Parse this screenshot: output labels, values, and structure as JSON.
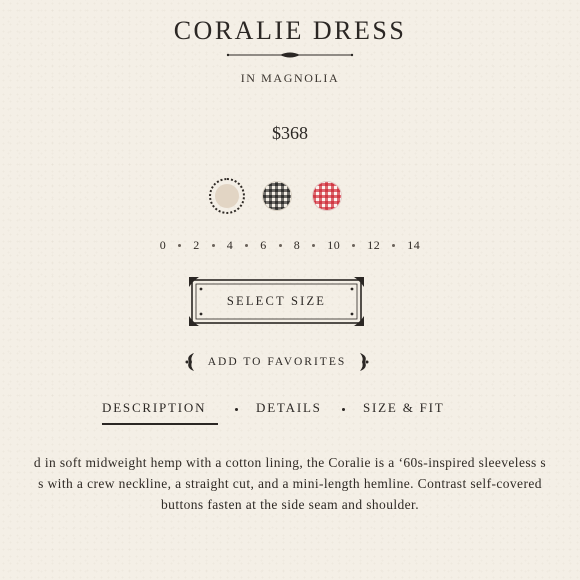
{
  "product": {
    "title": "CORALIE DRESS",
    "color_line": "IN MAGNOLIA",
    "price": "$368"
  },
  "swatches": [
    {
      "name": "Magnolia",
      "color": "#e2d5c4",
      "selected": true
    },
    {
      "name": "Black Gingham",
      "color": "#1d1d1d",
      "selected": false
    },
    {
      "name": "Red Gingham",
      "color": "#cd1e2d",
      "selected": false
    }
  ],
  "sizes": [
    "0",
    "2",
    "4",
    "6",
    "8",
    "10",
    "12",
    "14"
  ],
  "actions": {
    "select_size": "SELECT SIZE",
    "add_to_favorites": "ADD TO FAVORITES"
  },
  "tabs": [
    {
      "label": "DESCRIPTION",
      "active": true
    },
    {
      "label": "DETAILS",
      "active": false
    },
    {
      "label": "SIZE & FIT",
      "active": false
    }
  ],
  "description": {
    "lines": [
      "d in soft midweight hemp with a cotton lining, the Coralie is a ‘60s-inspired sleeveless s",
      "s with a crew neckline, a straight cut, and a mini-length hemline. Contrast self-covered",
      "buttons fasten at the side seam and shoulder."
    ]
  },
  "colors": {
    "text": "#2b2724",
    "background": "#f4efe6"
  }
}
